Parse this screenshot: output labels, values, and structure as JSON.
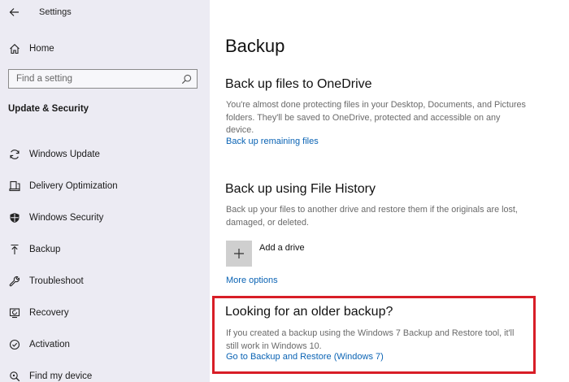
{
  "window": {
    "title": "Settings"
  },
  "sidebar": {
    "home_label": "Home",
    "search_placeholder": "Find a setting",
    "section_title": "Update & Security",
    "items": [
      {
        "label": "Windows Update",
        "icon": "sync-icon"
      },
      {
        "label": "Delivery Optimization",
        "icon": "delivery-optimization-icon"
      },
      {
        "label": "Windows Security",
        "icon": "shield-icon"
      },
      {
        "label": "Backup",
        "icon": "backup-arrow-icon"
      },
      {
        "label": "Troubleshoot",
        "icon": "wrench-icon"
      },
      {
        "label": "Recovery",
        "icon": "recovery-icon"
      },
      {
        "label": "Activation",
        "icon": "activation-icon"
      },
      {
        "label": "Find my device",
        "icon": "find-device-icon"
      }
    ]
  },
  "main": {
    "page_title": "Backup",
    "onedrive": {
      "heading": "Back up files to OneDrive",
      "description": "You're almost done protecting files in your Desktop, Documents, and Pictures folders. They'll be saved to OneDrive, protected and accessible on any device.",
      "link": "Back up remaining files"
    },
    "file_history": {
      "heading": "Back up using File History",
      "description": "Back up your files to another drive and restore them if the originals are lost, damaged, or deleted.",
      "add_drive_label": "Add a drive",
      "more_options_link": "More options"
    },
    "older_backup": {
      "heading": "Looking for an older backup?",
      "description": "If you created a backup using the Windows 7 Backup and Restore tool, it'll still work in Windows 10.",
      "link": "Go to Backup and Restore (Windows 7)"
    }
  },
  "colors": {
    "sidebar_bg": "#ecebf3",
    "link": "#0a63b4",
    "highlight": "#d81e27"
  }
}
